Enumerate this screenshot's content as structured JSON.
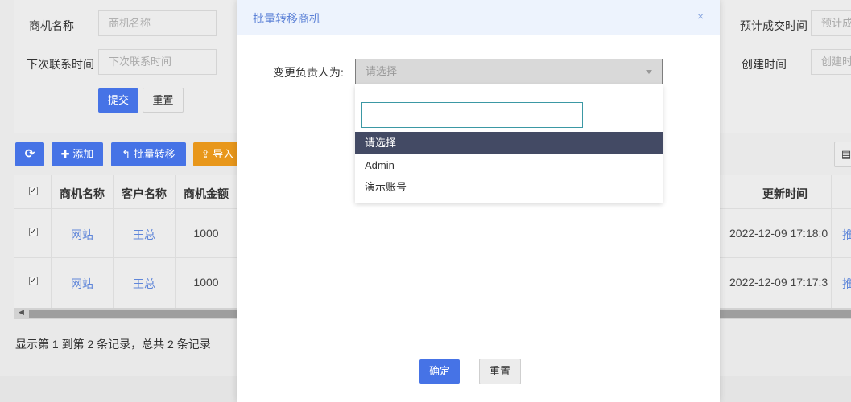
{
  "filter": {
    "name_label": "商机名称",
    "name_placeholder": "商机名称",
    "next_contact_label": "下次联系时间",
    "next_contact_placeholder": "下次联系时间",
    "expected_deal_label": "预计成交时间",
    "expected_deal_placeholder": "预计成交时间",
    "created_label": "创建时间",
    "created_placeholder": "创建时间",
    "submit_label": "提交",
    "reset_label": "重置"
  },
  "toolbar": {
    "refresh_icon": "refresh-icon",
    "add_label": "✚ 添加",
    "batch_transfer_label": "↰ 批量转移",
    "import_label": "⇪ 导入"
  },
  "table": {
    "headers": [
      "商机名称",
      "客户名称",
      "商机金额",
      "更新时间"
    ],
    "rows": [
      {
        "name": "网站",
        "customer": "王总",
        "amount": "1000",
        "updated": "2022-12-09 17:18:0",
        "op": "推"
      },
      {
        "name": "网站",
        "customer": "王总",
        "amount": "1000",
        "updated": "2022-12-09 17:17:3",
        "op": "推"
      }
    ],
    "footer": "显示第 1 到第 2 条记录，总共 2 条记录"
  },
  "modal": {
    "title": "批量转移商机",
    "close": "×",
    "field_label": "变更负责人为:",
    "select_placeholder": "请选择",
    "options": [
      "请选择",
      "Admin",
      "演示账号"
    ],
    "confirm_label": "确定",
    "reset_label": "重置"
  }
}
